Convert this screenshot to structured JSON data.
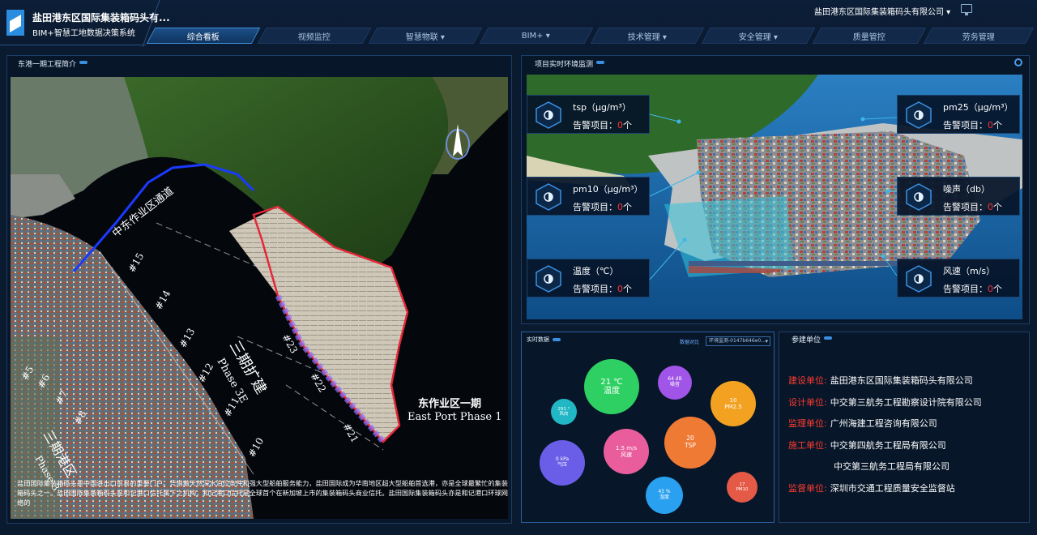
{
  "header": {
    "title": "盐田港东区国际集装箱码头有...",
    "subtitle": "BIM+智慧工地数据决策系统",
    "company": "盐田港东区国际集装箱码头有限公司 ▾"
  },
  "nav": [
    {
      "label": "综合看板"
    },
    {
      "label": "视频监控"
    },
    {
      "label": "智慧物联 ▾"
    },
    {
      "label": "BIM+ ▾"
    },
    {
      "label": "技术管理 ▾"
    },
    {
      "label": "安全管理 ▾"
    },
    {
      "label": "质量管控"
    },
    {
      "label": "劳务管理"
    }
  ],
  "project_intro": {
    "title": "东港一期工程简介",
    "map_label_cn": "东作业区一期",
    "map_label_en": "East Port Phase 1",
    "description": "盐田国际集装箱码头是中国进出口贸易的重要门户。凭借着天然深水泊位条件和强大型船舶服务能力，盐田国际成为华南地区超大型船舶首选港，亦是全球最繁忙的集装箱码头之一。盐田国际集装箱码头是和记港口信托属下之机构，和记港口信托是全球首个在新加坡上市的集装箱码头商业信托。盐田国际集装箱码头亦是和记港口环球网络的"
  },
  "env": {
    "title": "项目实时环境监测",
    "warn_prefix": "告警项目：",
    "warn_suffix": "个",
    "cards": [
      {
        "label": "tsp（μg/m³）",
        "count": "0"
      },
      {
        "label": "pm25（μg/m³）",
        "count": "0"
      },
      {
        "label": "pm10（μg/m³）",
        "count": "0"
      },
      {
        "label": "噪声（db）",
        "count": "0"
      },
      {
        "label": "温度（℃）",
        "count": "0"
      },
      {
        "label": "风速（m/s）",
        "count": "0"
      }
    ]
  },
  "realtime": {
    "title": "实时数据",
    "compare": "数据对比",
    "select_value": "环境监测-0147b646e0...",
    "bubbles": [
      {
        "value": "21 ℃",
        "name": "温度",
        "color": "#2fd063"
      },
      {
        "value": "64 dB",
        "name": "噪音",
        "color": "#a155e8"
      },
      {
        "value": "291 °",
        "name": "风向",
        "color": "#22b7c4"
      },
      {
        "value": "10",
        "name": "PM2.5",
        "color": "#f3a120"
      },
      {
        "value": "1.5 m/s",
        "name": "风速",
        "color": "#ea5d9c"
      },
      {
        "value": "20",
        "name": "TSP",
        "color": "#ef7a34"
      },
      {
        "value": "0 kPa",
        "name": "气压",
        "color": "#6a5ee8"
      },
      {
        "value": "45 %",
        "name": "湿度",
        "color": "#2aa0f0"
      },
      {
        "value": "17",
        "name": "PM10",
        "color": "#e45a47"
      }
    ]
  },
  "participants": {
    "title": "参建单位",
    "rows": [
      {
        "key": "建设单位:",
        "value": "盐田港东区国际集装箱码头有限公司"
      },
      {
        "key": "设计单位:",
        "value": "中交第三航务工程勘察设计院有限公司"
      },
      {
        "key": "监理单位:",
        "value": "广州海建工程咨询有限公司"
      },
      {
        "key": "施工单位:",
        "value": "中交第四航务工程局有限公司"
      },
      {
        "key": "",
        "value": "中交第三航务工程局有限公司"
      },
      {
        "key": "监督单位:",
        "value": "深圳市交通工程质量安全监督站"
      }
    ]
  }
}
